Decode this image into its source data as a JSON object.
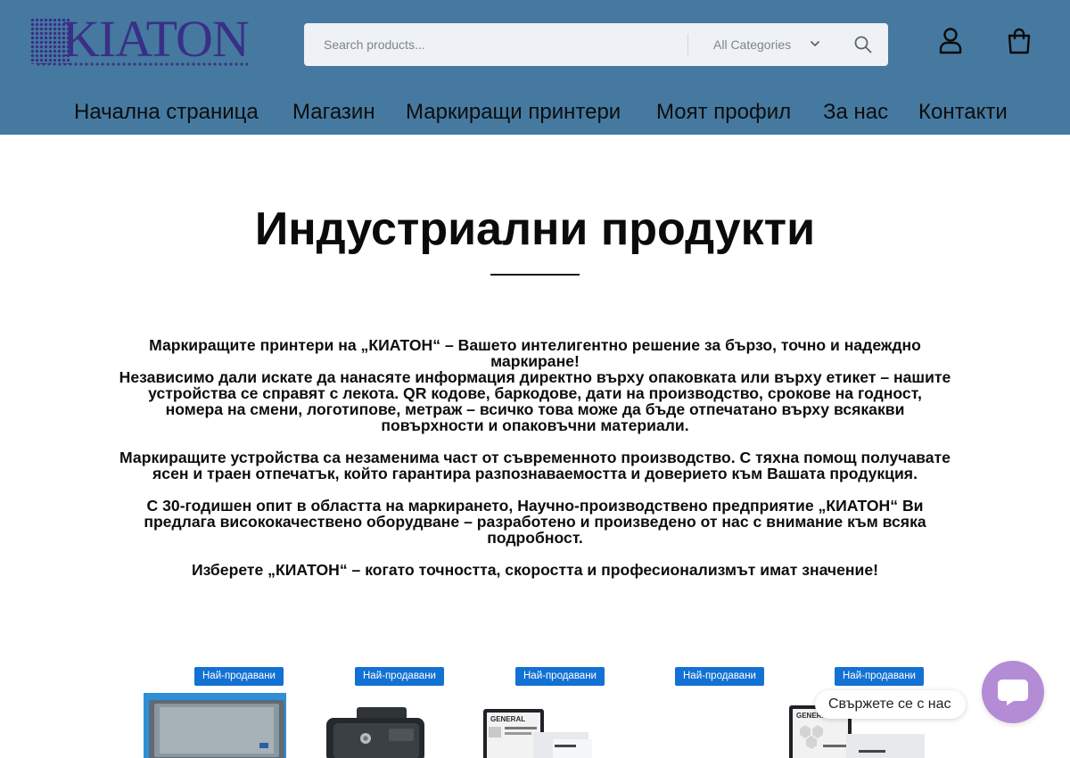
{
  "brand": {
    "logo_text": "KIATON"
  },
  "search": {
    "placeholder": "Search products...",
    "category": "All Categories"
  },
  "nav": {
    "items": [
      {
        "label": "Начална страница"
      },
      {
        "label": "Магазин"
      },
      {
        "label": "Маркиращи принтери"
      },
      {
        "label": "Моят профил"
      },
      {
        "label": "За нас"
      },
      {
        "label": "Контакти"
      }
    ]
  },
  "main": {
    "title": "Индустриални продукти",
    "paragraphs": [
      {
        "lines": [
          "Маркиращите принтери на „КИАТОН“ – Вашето интелигентно решение за бързо, точно и надеждно",
          "маркиране!",
          "Независимо дали искате да нанасяте информация директно върху опаковката или върху етикет – нашите",
          "устройства се справят с лекота. QR кодове, баркодове, дати на производство, срокове на годност,",
          "номера на смени, логотипове, метраж – всичко това може да бъде отпечатано върху всякакви",
          "повърхности и опаковъчни материали."
        ]
      },
      {
        "lines": [
          "Маркиращите устройства са незаменима част от съвременното производство. С тяхна помощ получавате",
          "ясен и траен отпечатък, който гарантира разпознаваемостта и доверието към Вашата продукция."
        ]
      },
      {
        "lines": [
          "С 30-годишен опит в областта на маркирането, Научно-производствено предприятие „КИАТОН“ Ви",
          "предлага висококачествено оборудване – разработено и произведено от нас с внимание към всяка",
          "подробност."
        ]
      },
      {
        "lines": [
          "Изберете „КИАТОН“ – когато точността, скоростта и професионализмът имат значение!"
        ]
      }
    ]
  },
  "products": [
    {
      "badge": "Най-продавани",
      "thumb_label": ""
    },
    {
      "badge": "Най-продавани",
      "thumb_label": ""
    },
    {
      "badge": "Най-продавани",
      "thumb_label": "GENERAL"
    },
    {
      "badge": "Най-продавани",
      "thumb_label": ""
    },
    {
      "badge": "Най-продавани",
      "thumb_label": "GENERAL"
    }
  ],
  "chat": {
    "label": "Свържете се с нас"
  },
  "colors": {
    "header_bg": "#4579a0",
    "badge_bg": "#1271d3",
    "chat_bg": "#b48cd6",
    "logo": "#3a2f86"
  }
}
